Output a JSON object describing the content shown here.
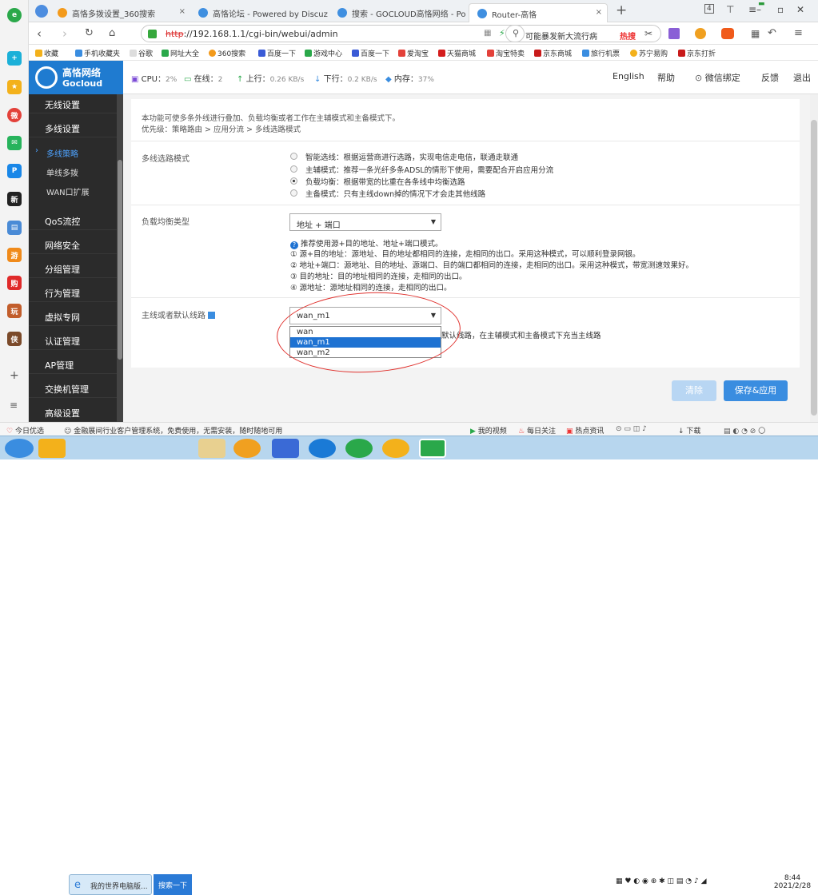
{
  "browser": {
    "tabs": [
      {
        "label": "高恪多拨设置_360搜索",
        "icon": "search-360-icon"
      },
      {
        "label": "高恪论坛 - Powered by Discuz",
        "icon": "cloud-icon"
      },
      {
        "label": "搜索 - GOCLOUD高恪网络 - Po",
        "icon": "cloud-icon"
      },
      {
        "label": "Router-高恪",
        "icon": "router-icon"
      }
    ],
    "tab_count": "4",
    "url_proto": "http",
    "url_rest": "://192.168.1.1/cgi-bin/webui/admin",
    "search_text": "可能暴发新大流行病",
    "search_hot": "热搜",
    "bookmarks": [
      "收藏",
      "手机收藏夹",
      "谷歌",
      "网址大全",
      "360搜索",
      "百度一下",
      "游戏中心",
      "百度一下",
      "爱淘宝",
      "天猫商城",
      "淘宝特卖",
      "京东商城",
      "旅行机票",
      "苏宁易购",
      "京东打折"
    ]
  },
  "header": {
    "logo_cn": "高恪网络",
    "logo_en": "Gocloud",
    "cpu_label": "CPU：",
    "cpu_val": "2%",
    "online_label": "在线：",
    "online_val": "2",
    "up_label": "上行：",
    "up_val": "0.26 KB/s",
    "down_label": "下行：",
    "down_val": "0.2 KB/s",
    "mem_label": "内存：",
    "mem_val": "37%",
    "links": [
      "English",
      "帮助",
      "微信绑定",
      "反馈",
      "退出"
    ]
  },
  "sidebar": {
    "items": [
      {
        "label": "无线设置"
      },
      {
        "label": "多线设置"
      },
      {
        "label": "多线策略"
      },
      {
        "label": "单线多拨"
      },
      {
        "label": "WAN口扩展"
      },
      {
        "label": "QoS流控"
      },
      {
        "label": "网络安全"
      },
      {
        "label": "分组管理"
      },
      {
        "label": "行为管理"
      },
      {
        "label": "虚拟专网"
      },
      {
        "label": "认证管理"
      },
      {
        "label": "AP管理"
      },
      {
        "label": "交换机管理"
      },
      {
        "label": "高级设置"
      }
    ]
  },
  "main": {
    "intro1": "本功能可使多条外线进行叠加、负载均衡或者工作在主辅模式和主备模式下。",
    "intro2": "优先级：策略路由 > 应用分流 > 多线选路模式",
    "mode_label": "多线选路模式",
    "modes": [
      "智能选线：根据运营商进行选路，实现电信走电信，联通走联通",
      "主辅模式：推荐一条光纤多条ADSL的情形下使用，需要配合开启应用分流",
      "负载均衡：根据带宽的比重在各条线中均衡选路",
      "主备模式：只有主线down掉的情况下才会走其他线路"
    ],
    "lb_label": "负载均衡类型",
    "lb_value": "地址 + 端口",
    "lb_tip": "推荐使用源+目的地址、地址+端口模式。",
    "lb_desc": [
      "① 源+目的地址：源地址、目的地址都相同的连接，走相同的出口。采用这种模式，可以顺利登录网银。",
      "② 地址+端口：源地址、目的地址、源端口、目的端口都相同的连接，走相同的出口。采用这种模式，带宽测速效果好。",
      "③ 目的地址：目的地址相同的连接，走相同的出口。",
      "④ 源地址：源地址相同的连接，走相同的出口。"
    ],
    "line_label": "主线或者默认线路",
    "line_value": "wan_m1",
    "line_options": [
      "wan",
      "wan_m1",
      "wan_m2"
    ],
    "line_desc": "默认线路，在主辅模式和主备模式下充当主线路",
    "btn_clear": "清除",
    "btn_save": "保存&应用"
  },
  "statusbar": {
    "left1": "今日优选",
    "left2": "金融展间行业客户管理系统，免费使用，无需安装，随时随地可用",
    "right": [
      "我的视频",
      "每日关注",
      "热点资讯",
      "下载"
    ]
  },
  "taskbar": {
    "items": [
      "我的世界电脑版...",
      "搜索一下"
    ],
    "time": "8:44",
    "date": "2021/2/28"
  }
}
